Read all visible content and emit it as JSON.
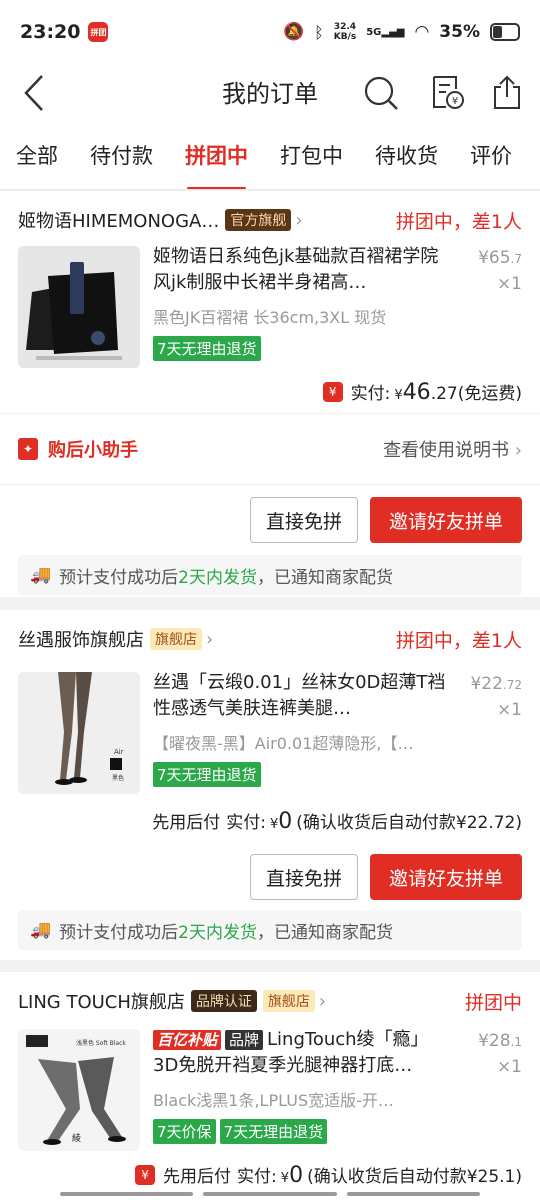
{
  "status": {
    "time": "23:20",
    "app_badge": "拼团",
    "net_speed_top": "32.4",
    "net_speed_bottom": "KB/s",
    "net_type": "5G",
    "battery": "35%"
  },
  "header": {
    "title": "我的订单"
  },
  "tabs": [
    "全部",
    "待付款",
    "拼团中",
    "打包中",
    "待收货",
    "评价"
  ],
  "active_tab": "拼团中",
  "colors": {
    "accent": "#e02e24",
    "green": "#2aa84a"
  },
  "orders": [
    {
      "shop": "姬物语HIMEMONOGA…",
      "badges": [
        "官方旗舰"
      ],
      "status": "拼团中，差1人",
      "title": "姬物语日系纯色jk基础款百褶裙学院风jk制服中长裙半身裙高…",
      "sku": "黑色JK百褶裙 长36cm,3XL 现货",
      "price_int": "¥65",
      "price_dec": ".7",
      "qty": "×1",
      "tags": [
        "7天无理由退货"
      ],
      "pay_label": "实付:",
      "pay_yen": "¥",
      "pay_int": "46",
      "pay_dec": ".27",
      "pay_note": "(免运费)",
      "pay_icon": "¥",
      "btn_free": "直接免拼",
      "btn_invite": "邀请好友拼单",
      "ship_pre": "预计支付成功后",
      "ship_hl": "2天内发货",
      "ship_post": "，已通知商家配货"
    },
    {
      "shop": "丝遇服饰旗舰店",
      "badges": [
        "旗舰店"
      ],
      "status": "拼团中，差1人",
      "title": "丝遇「云缎0.01」丝袜女0D超薄T裆性感透气美肤连裤美腿…",
      "sku": "【曜夜黑-黑】Air0.01超薄隐形,【…",
      "price_int": "¥22",
      "price_dec": ".72",
      "qty": "×1",
      "tags": [
        "7天无理由退货"
      ],
      "pay_prefix": "先用后付",
      "pay_label": "实付:",
      "pay_yen": "¥",
      "pay_int": "0",
      "pay_note": "(确认收货后自动付款¥22.72)",
      "thumb_text_a": "Air",
      "thumb_text_b": "黑色",
      "btn_free": "直接免拼",
      "btn_invite": "邀请好友拼单",
      "ship_pre": "预计支付成功后",
      "ship_hl": "2天内发货",
      "ship_post": "，已通知商家配货"
    },
    {
      "shop": "LING TOUCH旗舰店",
      "badges": [
        "品牌认证",
        "旗舰店"
      ],
      "status": "拼团中",
      "badge_butie": "百亿补贴",
      "badge_brand": "品牌",
      "title": "LingTouch绫「瘾」3D免脱开裆夏季光腿神器打底…",
      "sku": "Black浅黑1条,LPLUS宽适版-开…",
      "price_int": "¥28",
      "price_dec": ".1",
      "qty": "×1",
      "tags": [
        "7天价保",
        "7天无理由退货"
      ],
      "thumb_label": "浅黑色 Soft Black",
      "thumb_logo": "綾",
      "pay_prefix": "先用后付",
      "pay_label": "实付:",
      "pay_yen": "¥",
      "pay_int": "0",
      "pay_note": "(确认收货后自动付款¥25.1)",
      "pay_icon": "¥"
    }
  ],
  "helper": {
    "label": "购后小助手",
    "link": "查看使用说明书"
  }
}
